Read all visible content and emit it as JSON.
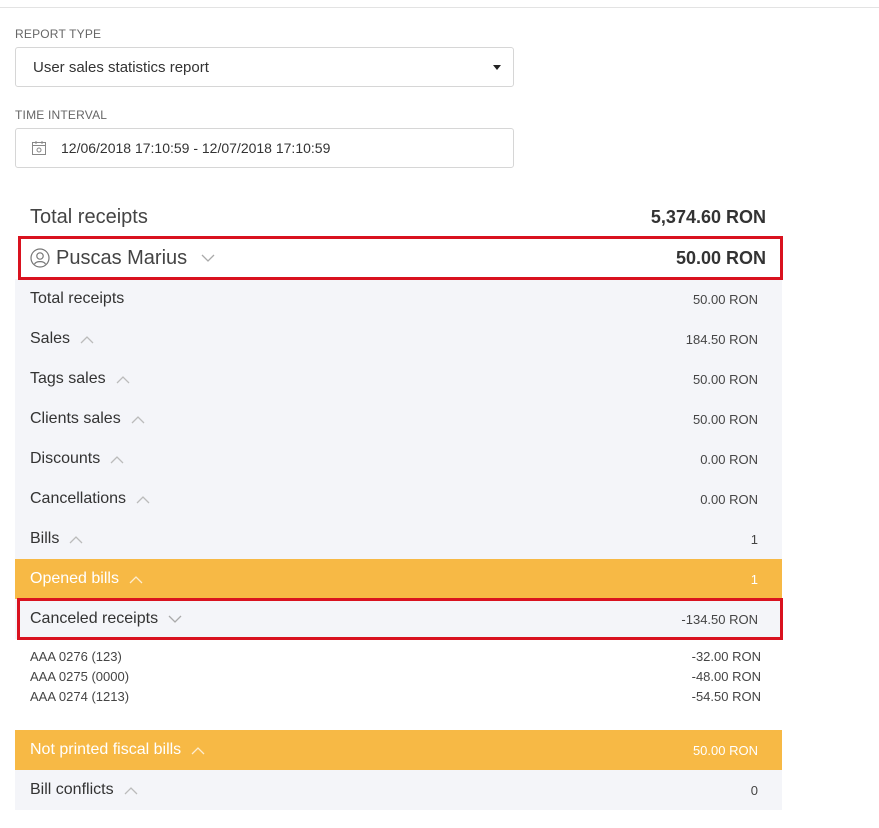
{
  "report_type": {
    "label": "REPORT TYPE",
    "value": "User sales statistics report"
  },
  "time_interval": {
    "label": "TIME INTERVAL",
    "value": "12/06/2018 17:10:59 - 12/07/2018 17:10:59"
  },
  "summary": {
    "total_label": "Total receipts",
    "total_value": "5,374.60 RON"
  },
  "user": {
    "name": "Puscas Marius",
    "value": "50.00 RON"
  },
  "rows": [
    {
      "label": "Total receipts",
      "value": "50.00 RON"
    },
    {
      "label": "Sales",
      "value": "184.50 RON"
    },
    {
      "label": "Tags sales",
      "value": "50.00 RON"
    },
    {
      "label": "Clients sales",
      "value": "50.00 RON"
    },
    {
      "label": "Discounts",
      "value": "0.00 RON"
    },
    {
      "label": "Cancellations",
      "value": "0.00 RON"
    },
    {
      "label": "Bills",
      "value": "1"
    },
    {
      "label": "Opened bills",
      "value": "1"
    },
    {
      "label": "Canceled receipts",
      "value": "-134.50 RON"
    }
  ],
  "canceled_list": [
    {
      "label": "AAA 0276 (123)",
      "value": "-32.00 RON"
    },
    {
      "label": "AAA 0275 (0000)",
      "value": "-48.00 RON"
    },
    {
      "label": "AAA 0274 (1213)",
      "value": "-54.50 RON"
    }
  ],
  "bottom_rows": [
    {
      "label": "Not printed fiscal bills",
      "value": "50.00 RON"
    },
    {
      "label": "Bill conflicts",
      "value": "0"
    }
  ],
  "colors": {
    "highlight": "#f7b945",
    "annotation": "#d9121f",
    "row_bg": "#f4f5f9"
  }
}
